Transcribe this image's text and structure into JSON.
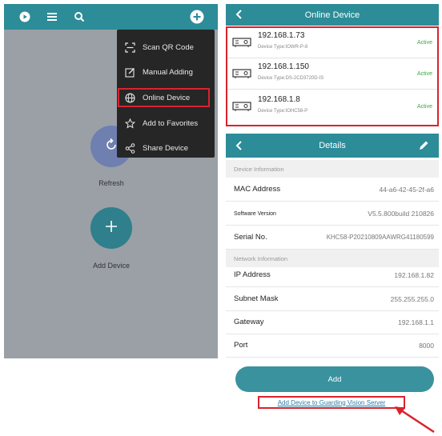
{
  "left_panel": {
    "refresh_label": "Refresh",
    "add_device_label": "Add Device",
    "menu": [
      {
        "label": "Scan QR Code",
        "icon": "scan-qr-icon"
      },
      {
        "label": "Manual Adding",
        "icon": "edit-icon"
      },
      {
        "label": "Online Device",
        "icon": "globe-icon"
      },
      {
        "label": "Add to Favorites",
        "icon": "star-icon"
      },
      {
        "label": "Share Device",
        "icon": "share-icon"
      }
    ]
  },
  "online_device": {
    "title": "Online Device",
    "devices": [
      {
        "ip": "192.168.1.73",
        "type": "Device Type:IOWR-P-8",
        "status": "Active"
      },
      {
        "ip": "192.168.1.150",
        "type": "Device Type:DS-2CD3720D-IS",
        "status": "Active"
      },
      {
        "ip": "192.168.1.8",
        "type": "Device Type:IOHC58-P",
        "status": "Active"
      }
    ]
  },
  "details": {
    "title": "Details",
    "device_info_header": "Device Information",
    "mac_label": "MAC Address",
    "mac_value": "44-a6-42-45-2f-a6",
    "sw_label": "Software Version",
    "sw_value": "V5.5.800build 210826",
    "serial_label": "Serial No.",
    "serial_value": "KHC58-P20210809AAWRG41180599",
    "network_info_header": "Network Information",
    "ip_label": "IP Address",
    "ip_value": "192.168.1.82",
    "mask_label": "Subnet Mask",
    "mask_value": "255.255.255.0",
    "gateway_label": "Gateway",
    "gateway_value": "192.168.1.1",
    "port_label": "Port",
    "port_value": "8000",
    "add_button": "Add",
    "server_link": "Add Device to Guarding Vision Server"
  },
  "colors": {
    "teal": "#2c8c98",
    "highlight_red": "#d9232e",
    "active_green": "#3aa544"
  }
}
